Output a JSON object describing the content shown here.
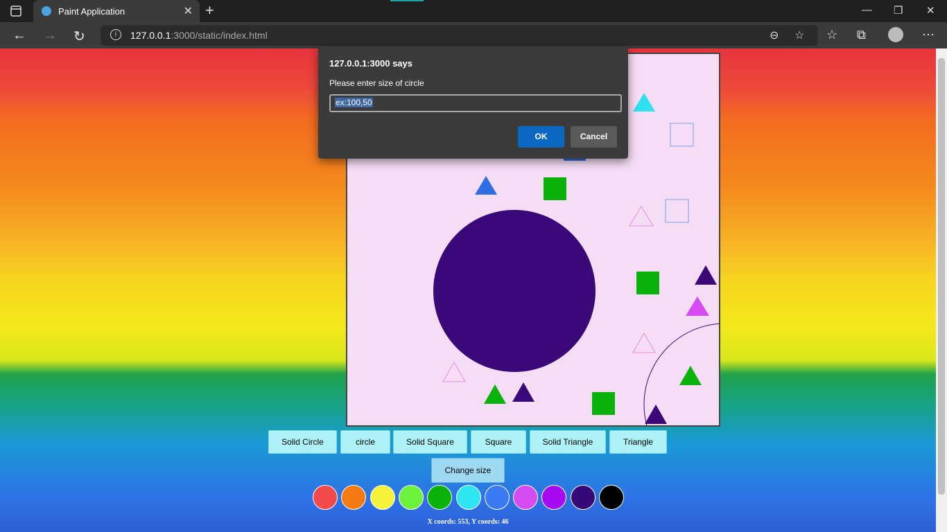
{
  "browser": {
    "tab_title": "Paint Application",
    "tab_close": "✕",
    "new_tab": "+",
    "url_host": "127.0.0.1",
    "url_rest": ":3000/static/index.html",
    "window_controls": {
      "minimize": "—",
      "maximize": "❐",
      "close": "✕"
    },
    "icons": [
      "back-icon",
      "forward-icon",
      "reload-icon",
      "zoom-out-icon",
      "favorite-add-icon",
      "favorites-icon",
      "collections-icon",
      "profile-icon",
      "more-icon"
    ]
  },
  "dialog": {
    "title": "127.0.0.1:3000 says",
    "message": "Please enter size of circle",
    "input_value": "ex:100,50",
    "ok_label": "OK",
    "cancel_label": "Cancel"
  },
  "toolbar": {
    "buttons": [
      "Solid Circle",
      "circle",
      "Solid Square",
      "Square",
      "Solid Triangle",
      "Triangle"
    ],
    "change_size_label": "Change size"
  },
  "palette": [
    "#f24a4a",
    "#f57a12",
    "#f6f23a",
    "#6cf23a",
    "#0ab20a",
    "#2ee6f2",
    "#3a7af2",
    "#d64af2",
    "#a60af2",
    "#36097a",
    "#000000"
  ],
  "status": {
    "coords": "X coords: 553, Y coords: 46"
  },
  "canvas": {
    "background": "#f6ddf6",
    "colors": {
      "cyan": "#2ee0f0",
      "blue": "#2f6ee6",
      "green": "#0ab20a",
      "violet": "#3a0878",
      "magenta": "#d64af2",
      "light-blue-outline": "#7a9ae6",
      "pink-outline": "#e48fe0"
    }
  }
}
